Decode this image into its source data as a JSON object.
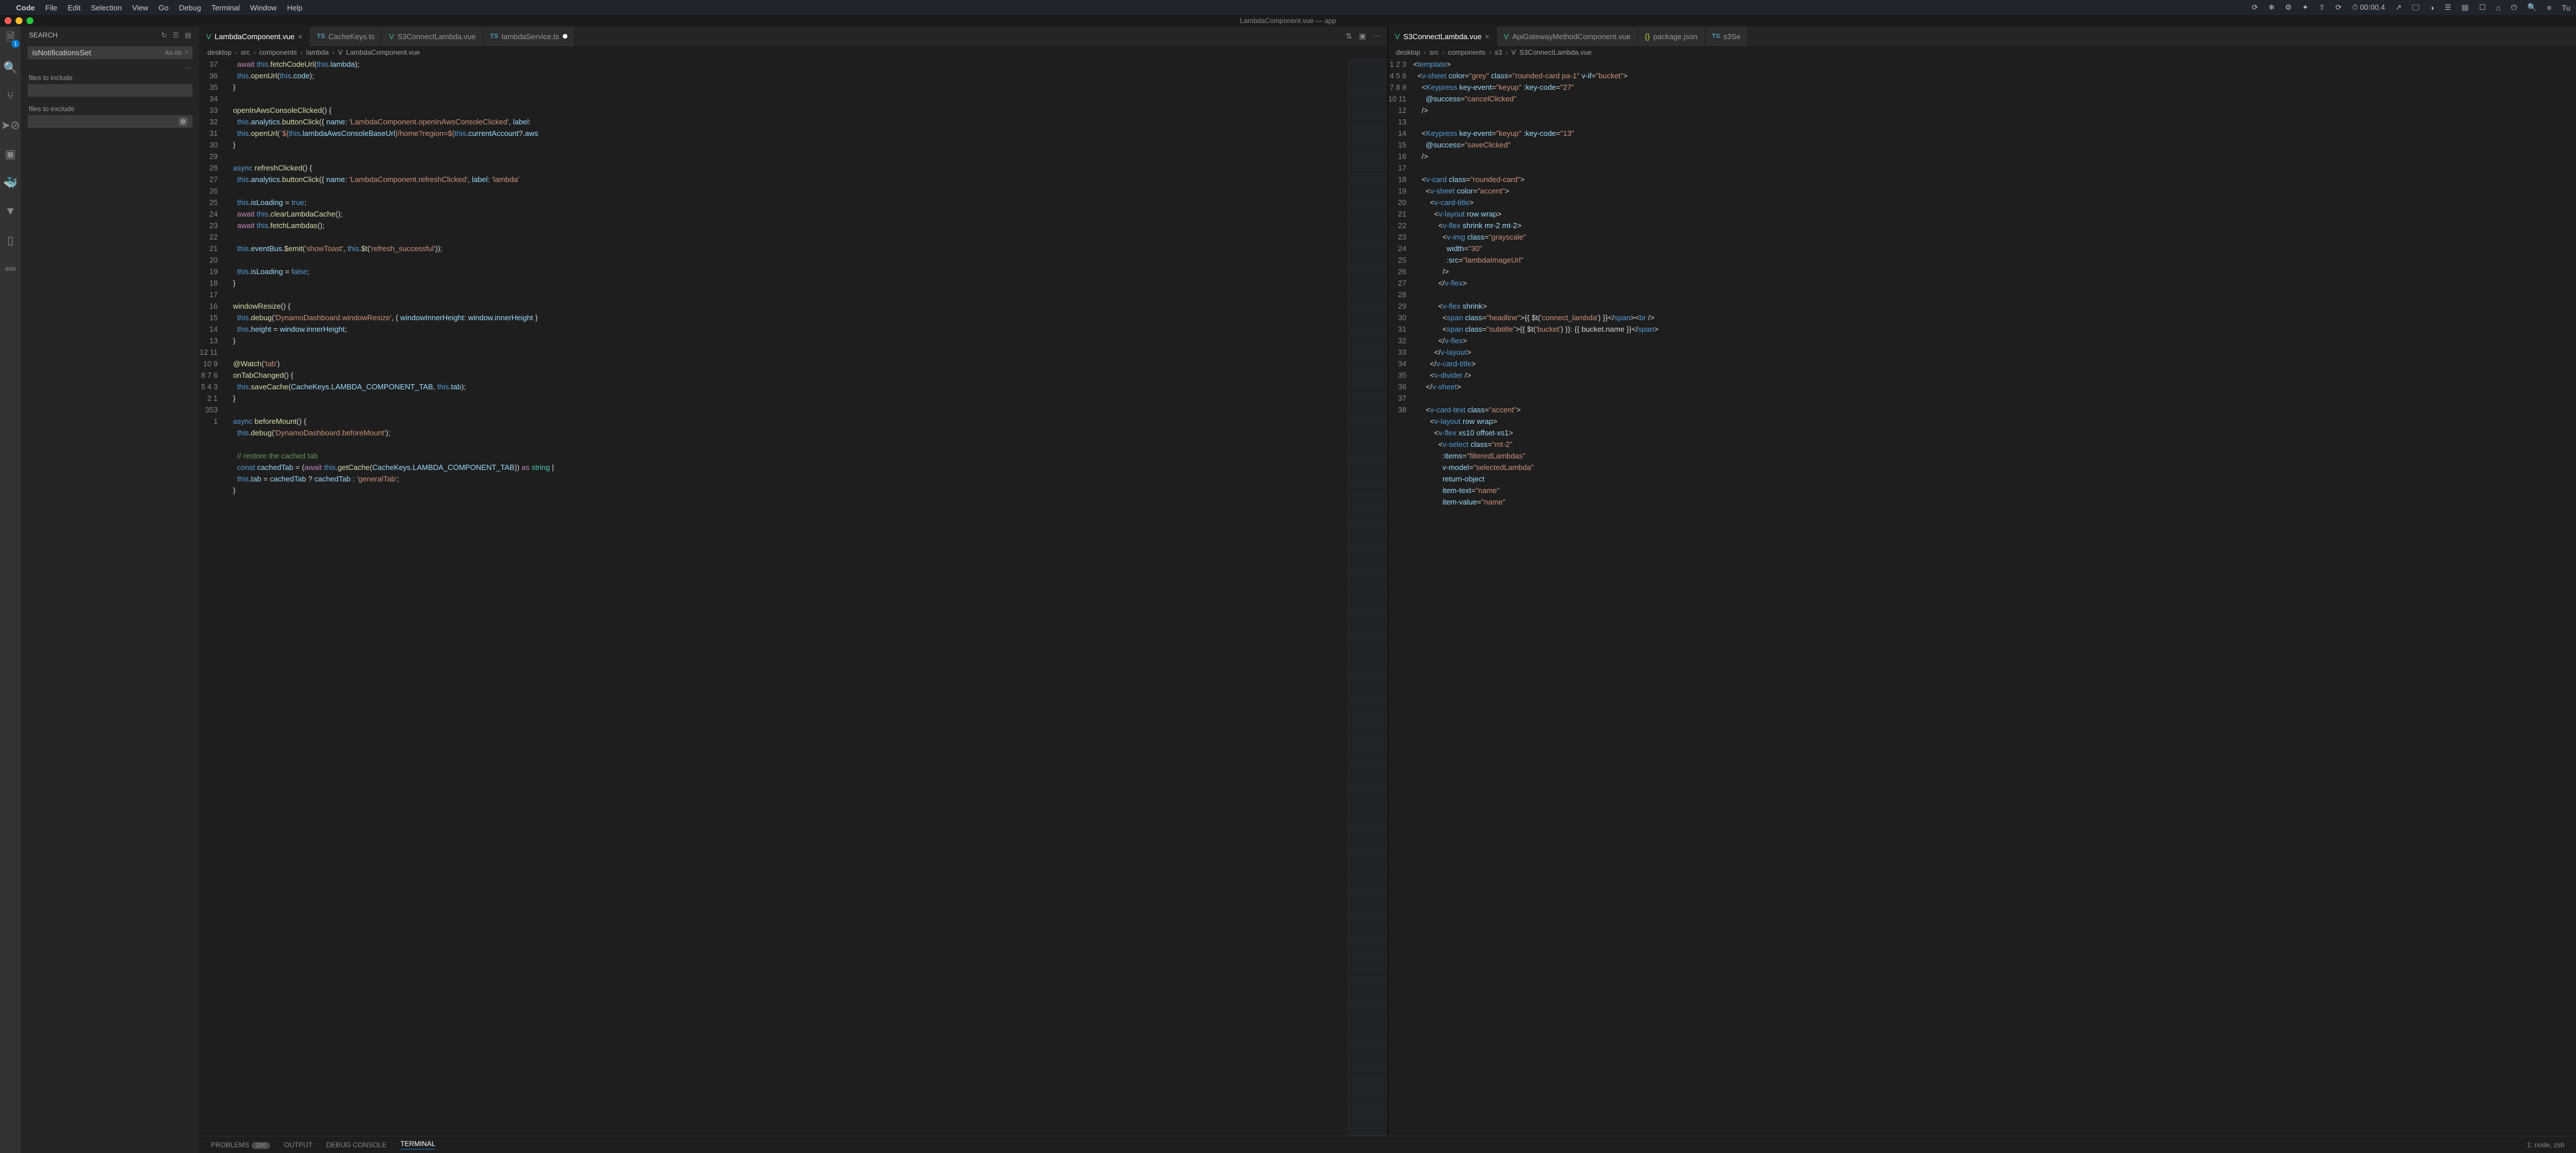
{
  "menu": {
    "apple": "",
    "items": [
      "Code",
      "File",
      "Edit",
      "Selection",
      "View",
      "Go",
      "Debug",
      "Terminal",
      "Window",
      "Help"
    ],
    "right": [
      "⟳",
      "❄︎",
      "⚙︎",
      "✦",
      "⇪",
      "⟳",
      "⏱ 00:00.4",
      "↗",
      "🖵",
      "◑",
      "☰",
      "▤",
      "☐",
      "⌂",
      "⏻",
      "🔍",
      "≡",
      "Tu"
    ]
  },
  "title": "LambdaComponent.vue — app",
  "sidebar": {
    "title": "SEARCH",
    "query": "isNotificationsSet",
    "opts": "Aa  Ab  .*",
    "labels": {
      "inc": "files to include",
      "exc": "files to exclude",
      "more": "…"
    }
  },
  "tabs_left": [
    {
      "icon": "vue",
      "label": "LambdaComponent.vue",
      "active": true,
      "close": true
    },
    {
      "icon": "ts",
      "label": "CacheKeys.ts"
    },
    {
      "icon": "vue",
      "label": "S3ConnectLambda.vue"
    },
    {
      "icon": "ts",
      "label": "lambdaService.ts",
      "dirty": true
    }
  ],
  "tabs_left_actions": [
    "⇅",
    "▣",
    "⋯"
  ],
  "tabs_right": [
    {
      "icon": "vue",
      "label": "S3ConnectLambda.vue",
      "active": true,
      "close": true
    },
    {
      "icon": "vue",
      "label": "ApiGatewayMethodComponent.vue"
    },
    {
      "icon": "json",
      "label": "package.json"
    },
    {
      "icon": "ts",
      "label": "s3Se"
    }
  ],
  "crumbs_left": [
    "desktop",
    "src",
    "components",
    "lambda",
    "",
    "LambdaComponent.vue"
  ],
  "crumbs_right": [
    "desktop",
    "src",
    "components",
    "s3",
    "",
    "S3ConnectLambda.vue"
  ],
  "code_left": {
    "nums": [
      37,
      36,
      35,
      34,
      33,
      32,
      31,
      30,
      29,
      28,
      27,
      26,
      25,
      24,
      23,
      22,
      21,
      20,
      19,
      18,
      17,
      16,
      15,
      14,
      13,
      12,
      11,
      10,
      9,
      8,
      7,
      6,
      5,
      4,
      3,
      2,
      1,
      353,
      1
    ]
  },
  "code_right": {
    "nums": [
      1,
      2,
      3,
      4,
      5,
      6,
      7,
      8,
      9,
      10,
      11,
      12,
      13,
      14,
      15,
      16,
      17,
      18,
      19,
      20,
      21,
      22,
      23,
      24,
      25,
      26,
      27,
      28,
      29,
      30,
      31,
      32,
      33,
      34,
      35,
      36,
      37,
      38
    ]
  },
  "panel": {
    "items": [
      "PROBLEMS",
      "OUTPUT",
      "DEBUG CONSOLE",
      "TERMINAL"
    ],
    "count": "286",
    "active": 3,
    "right": "1: node, zsh"
  }
}
